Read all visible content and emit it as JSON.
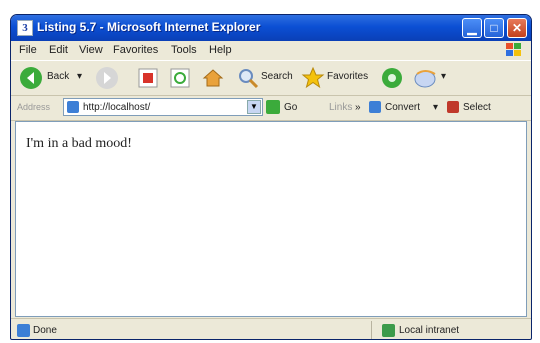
{
  "window": {
    "title": "Listing 5.7 - Microsoft Internet Explorer",
    "app_icon": "3",
    "controls": [
      "minimize-icon",
      "maximize-icon",
      "close-icon"
    ]
  },
  "menubar": {
    "items": [
      "File",
      "Edit",
      "View",
      "Favorites",
      "Tools",
      "Help"
    ]
  },
  "toolbar": {
    "back": "Back",
    "search": "Search",
    "favorites": "Favorites",
    "icons": [
      "back-icon",
      "forward-icon",
      "stop-icon",
      "refresh-icon",
      "home-icon",
      "search-icon",
      "favorites-star-icon",
      "media-icon",
      "history-icon"
    ]
  },
  "addressbar": {
    "label": "Address",
    "url": "http://localhost/",
    "go": "Go",
    "links": "Links",
    "convert": "Convert",
    "select": "Select"
  },
  "content": {
    "text": "I'm in a bad mood!"
  },
  "statusbar": {
    "left": "Done",
    "zone": "Local intranet"
  },
  "colors": {
    "titlebar": "#0b4fd4",
    "chrome": "#ece9d8",
    "go": "#3bab3b"
  }
}
